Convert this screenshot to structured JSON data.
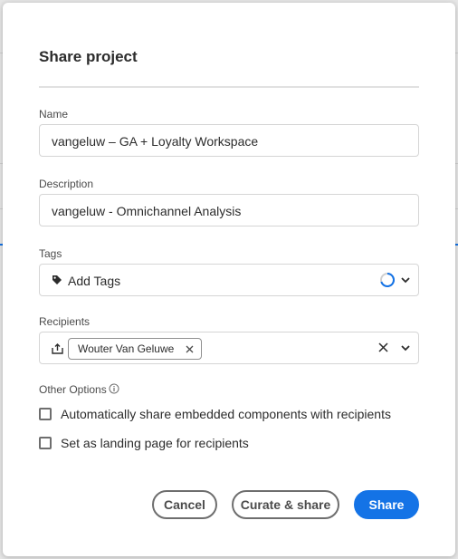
{
  "dialog": {
    "title": "Share project"
  },
  "name": {
    "label": "Name",
    "value": "vangeluw – GA + Loyalty Workspace"
  },
  "description": {
    "label": "Description",
    "value": "vangeluw - Omnichannel Analysis"
  },
  "tags": {
    "label": "Tags",
    "placeholder": "Add Tags",
    "loading": true
  },
  "recipients": {
    "label": "Recipients",
    "chips": [
      "Wouter Van Geluwe"
    ]
  },
  "options": {
    "label": "Other Options",
    "items": [
      {
        "label": "Automatically share embedded components with recipients",
        "checked": false
      },
      {
        "label": "Set as landing page for recipients",
        "checked": false
      }
    ]
  },
  "buttons": {
    "cancel": "Cancel",
    "curate": "Curate & share",
    "share": "Share"
  },
  "colors": {
    "accent": "#1473e6"
  },
  "icons": [
    "tag-icon",
    "spinner-icon",
    "chevron-down-icon",
    "share-icon",
    "close-icon",
    "info-icon"
  ]
}
